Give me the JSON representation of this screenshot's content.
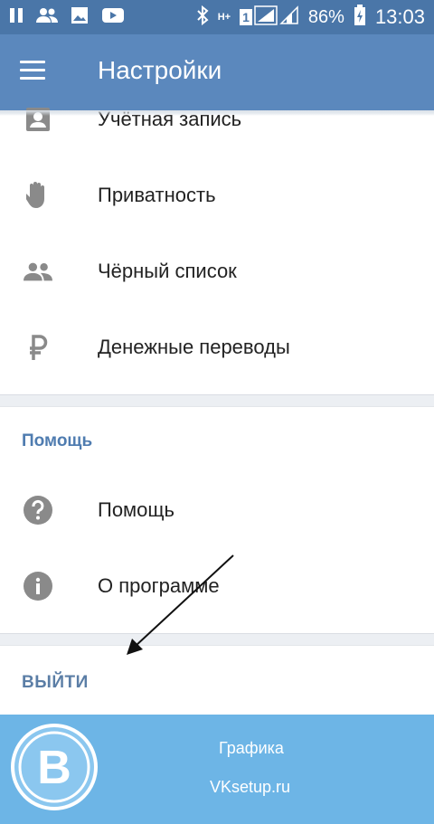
{
  "status_bar": {
    "network_type": "H+",
    "sim": "1",
    "battery": "86%",
    "time": "13:03",
    "icons": [
      "pause-icon",
      "people-icon",
      "image-icon",
      "youtube-icon",
      "bluetooth-icon",
      "signal-icon",
      "battery-charging-icon"
    ]
  },
  "toolbar": {
    "title": "Настройки",
    "menu_icon": "hamburger-menu-icon"
  },
  "settings_items": [
    {
      "label": "Учётная запись",
      "icon": "account-icon"
    },
    {
      "label": "Приватность",
      "icon": "hand-icon"
    },
    {
      "label": "Чёрный список",
      "icon": "people-icon"
    },
    {
      "label": "Денежные переводы",
      "icon": "ruble-icon"
    }
  ],
  "help_section": {
    "header": "Помощь",
    "items": [
      {
        "label": "Помощь",
        "icon": "help-icon"
      },
      {
        "label": "О программе",
        "icon": "info-icon"
      }
    ]
  },
  "logout_label": "ВЫЙТИ",
  "watermark": {
    "line1": "Графика",
    "line2": "VKsetup.ru",
    "logo_letter": "B"
  },
  "colors": {
    "status_bar": "#4a76a8",
    "toolbar": "#5b88bd",
    "accent": "#4f7cb0",
    "watermark_bg": "#6db5e6",
    "icon_gray": "#8a8a8a"
  }
}
